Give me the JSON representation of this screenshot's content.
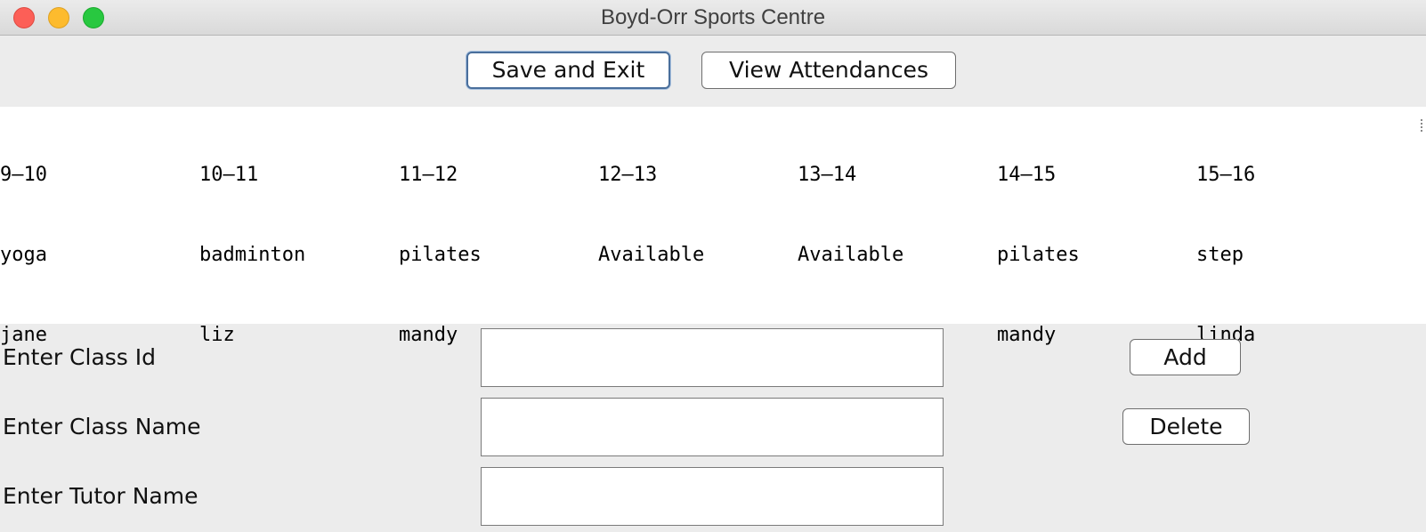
{
  "window": {
    "title": "Boyd-Orr Sports Centre"
  },
  "toolbar": {
    "save_label": "Save and Exit",
    "view_label": "View Attendances"
  },
  "timetable": {
    "slots": [
      {
        "time": "9–10",
        "class": "yoga",
        "tutor": "jane"
      },
      {
        "time": "10–11",
        "class": "badminton",
        "tutor": "liz"
      },
      {
        "time": "11–12",
        "class": "pilates",
        "tutor": "mandy"
      },
      {
        "time": "12–13",
        "class": "Available",
        "tutor": ""
      },
      {
        "time": "13–14",
        "class": "Available",
        "tutor": ""
      },
      {
        "time": "14–15",
        "class": "pilates",
        "tutor": "mandy"
      },
      {
        "time": "15–16",
        "class": "step",
        "tutor": "linda"
      }
    ]
  },
  "form": {
    "class_id_label": "Enter Class Id",
    "class_id_value": "",
    "class_name_label": "Enter Class Name",
    "class_name_value": "",
    "tutor_name_label": "Enter Tutor Name",
    "tutor_name_value": "",
    "add_label": "Add",
    "delete_label": "Delete"
  }
}
